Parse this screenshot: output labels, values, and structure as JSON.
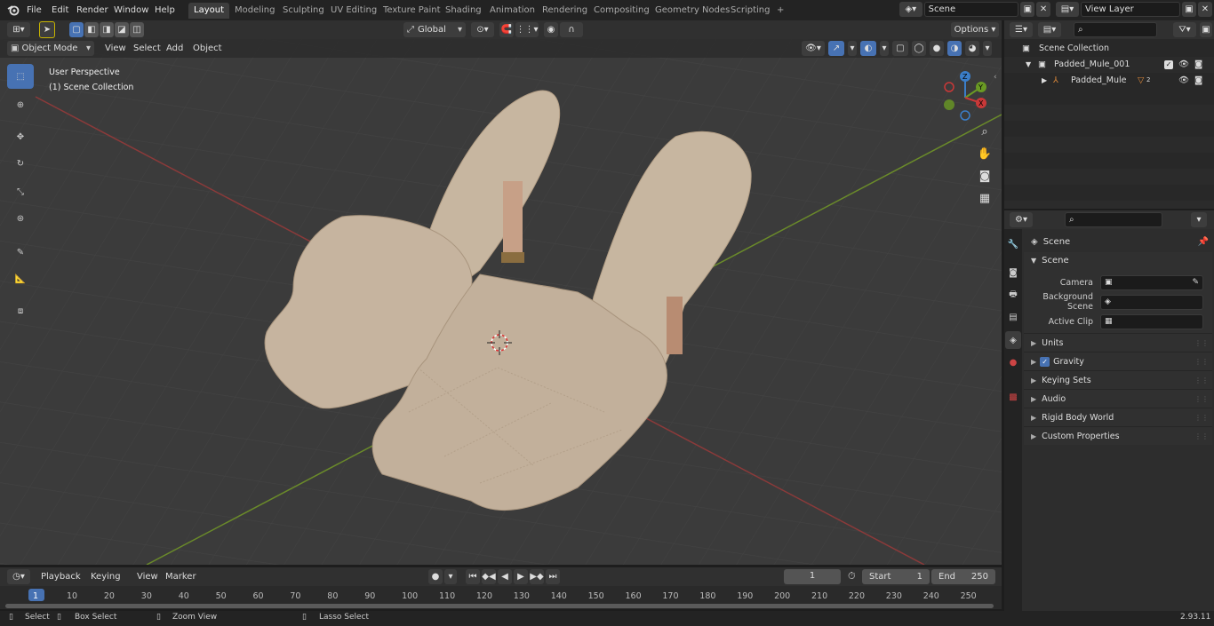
{
  "menus": [
    "File",
    "Edit",
    "Render",
    "Window",
    "Help"
  ],
  "workspaces": [
    "Layout",
    "Modeling",
    "Sculpting",
    "UV Editing",
    "Texture Paint",
    "Shading",
    "Animation",
    "Rendering",
    "Compositing",
    "Geometry Nodes",
    "Scripting",
    "+"
  ],
  "active_workspace": "Layout",
  "scene_name": "Scene",
  "view_layer_name": "View Layer",
  "viewport_header": {
    "mode": "Object Mode",
    "menus": [
      "View",
      "Select",
      "Add",
      "Object"
    ],
    "transform_orientation": "Global",
    "options_label": "Options"
  },
  "viewport_overlay": {
    "perspective": "User Perspective",
    "collection": "(1) Scene Collection"
  },
  "outliner": {
    "root": "Scene Collection",
    "items": [
      {
        "name": "Padded_Mule_001"
      },
      {
        "name": "Padded_Mule",
        "badge": "2"
      }
    ]
  },
  "properties": {
    "breadcrumb": "Scene",
    "panel": "Scene",
    "fields": [
      {
        "label": "Camera"
      },
      {
        "label": "Background Scene"
      },
      {
        "label": "Active Clip"
      }
    ],
    "sections": [
      "Units",
      "Gravity",
      "Keying Sets",
      "Audio",
      "Rigid Body World",
      "Custom Properties"
    ]
  },
  "timeline": {
    "menus": [
      "Playback",
      "Keying",
      "View",
      "Marker"
    ],
    "current_frame": "1",
    "start_label": "Start",
    "start": "1",
    "end_label": "End",
    "end": "250",
    "ruler": [
      "1",
      "10",
      "20",
      "30",
      "40",
      "50",
      "60",
      "70",
      "80",
      "90",
      "100",
      "110",
      "120",
      "130",
      "140",
      "150",
      "160",
      "170",
      "180",
      "190",
      "200",
      "210",
      "220",
      "230",
      "240",
      "250"
    ]
  },
  "statusbar": {
    "items": [
      "Select",
      "Box Select",
      "Zoom View",
      "Lasso Select"
    ],
    "version": "2.93.11"
  },
  "colors": {
    "accent": "#4772b3",
    "model": "#c6b49f",
    "x_axis": "#8b3a3a",
    "y_axis": "#6a8a2a"
  }
}
